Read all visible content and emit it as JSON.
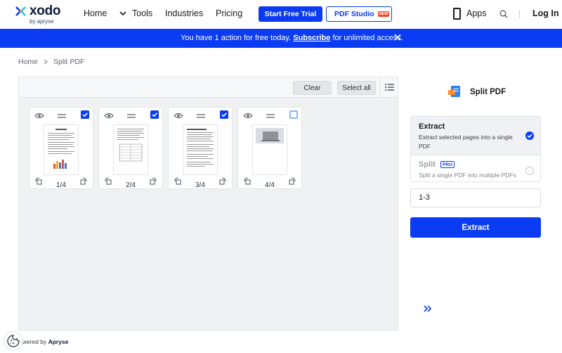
{
  "header": {
    "logo_text": "xodo",
    "logo_sub": "by apryse",
    "nav": [
      "Home",
      "Tools",
      "Industries",
      "Pricing"
    ],
    "trial_label": "Start Free Trial",
    "studio_label": "PDF Studio",
    "studio_badge": "NEW",
    "apps_label": "Apps",
    "login_label": "Log In"
  },
  "banner": {
    "prefix": "You have 1 action for free today.",
    "link": "Subscribe",
    "suffix": "for unlimited access."
  },
  "breadcrumb": [
    "Home",
    "Split PDF"
  ],
  "toolbar": {
    "clear_label": "Clear",
    "select_all_label": "Select all"
  },
  "pages": [
    {
      "label": "1/4",
      "selected": true
    },
    {
      "label": "2/4",
      "selected": true
    },
    {
      "label": "3/4",
      "selected": true
    },
    {
      "label": "4/4",
      "selected": false
    }
  ],
  "panel": {
    "title": "Split PDF",
    "extract_title": "Extract",
    "extract_desc": "Extract selected pages into a single PDF",
    "split_title": "Split",
    "split_badge": "PRO",
    "split_desc": "Split a single PDF into multiple PDFs",
    "range_value": "1-3",
    "extract_button": "Extract"
  },
  "footer": {
    "powered_prefix": "owered by",
    "powered_brand": "Apryse"
  },
  "colors": {
    "primary": "#0b3cf4",
    "workspace_bg": "#f0f1f3"
  }
}
